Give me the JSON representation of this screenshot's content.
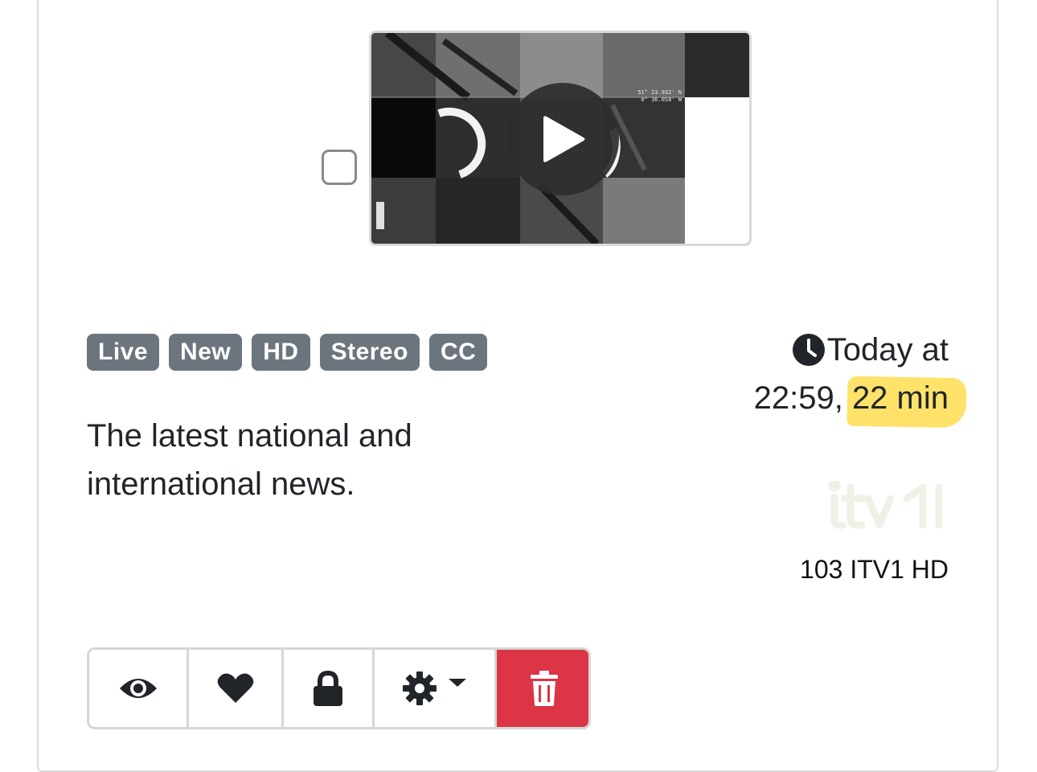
{
  "programme": {
    "badges": [
      "Live",
      "New",
      "HD",
      "Stereo",
      "CC"
    ],
    "description": "The latest national and international news.",
    "time_prefix": "Today at",
    "time_clock": "22:59,",
    "duration": "22 min",
    "channel": "103 ITV1 HD",
    "thumbnail_overlay": {
      "lat": "51° 23.932' N",
      "lon": "0° 36.058' W"
    }
  },
  "icons": {
    "select": "checkbox-icon",
    "play": "play-icon",
    "clock": "clock-icon",
    "logo": "itv1-logo",
    "watch": "eye-icon",
    "favourite": "heart-icon",
    "protect": "lock-icon",
    "settings": "gear-icon",
    "menu": "caret-down-icon",
    "delete": "trash-icon"
  },
  "colors": {
    "badge_bg": "#6c757d",
    "delete_bg": "#dc3545",
    "highlight": "#ffe26a"
  }
}
